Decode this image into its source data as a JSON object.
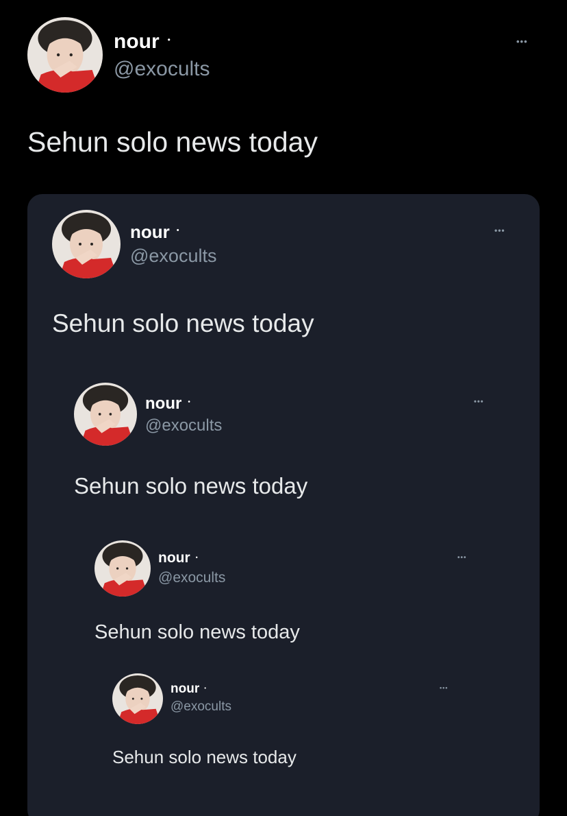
{
  "tweet": {
    "name": "nour",
    "lock_glyph": "•",
    "handle": "@exocults",
    "more": "•••",
    "text": "Sehun solo news today"
  },
  "quote_1": {
    "name": "nour",
    "lock_glyph": "•",
    "handle": "@exocults",
    "more": "•••",
    "text": "Sehun solo news today"
  },
  "quote_2": {
    "name": "nour",
    "lock_glyph": "•",
    "handle": "@exocults",
    "more": "•••",
    "text": "Sehun solo news today"
  },
  "quote_3": {
    "name": "nour",
    "lock_glyph": "•",
    "handle": "@exocults",
    "more": "•••",
    "text": "Sehun solo news today"
  },
  "quote_4": {
    "name": "nour",
    "lock_glyph": "•",
    "handle": "@exocults",
    "more": "•••",
    "text": "Sehun solo news today"
  },
  "colors": {
    "background": "#000000",
    "quote_card": "#1b1f2a",
    "secondary_text": "#8b98a5",
    "avatar_shirt": "#d42a2a"
  }
}
